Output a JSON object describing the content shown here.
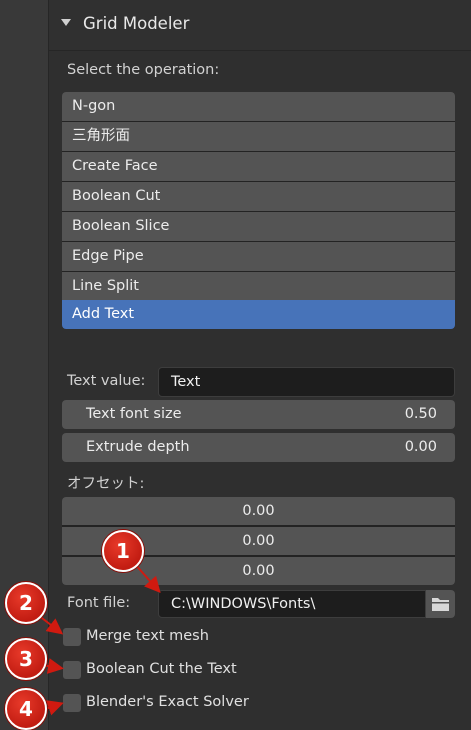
{
  "panel": {
    "title": "Grid Modeler",
    "operation_prompt": "Select the operation:",
    "operations": [
      {
        "label": "N-gon",
        "selected": false
      },
      {
        "label": "三角形面",
        "selected": false
      },
      {
        "label": "Create Face",
        "selected": false
      },
      {
        "label": "Boolean Cut",
        "selected": false
      },
      {
        "label": "Boolean Slice",
        "selected": false
      },
      {
        "label": "Edge Pipe",
        "selected": false
      },
      {
        "label": "Line Split",
        "selected": false
      },
      {
        "label": "Add Text",
        "selected": true
      }
    ],
    "text_value": {
      "label": "Text value:",
      "value": "Text"
    },
    "font_size": {
      "label": "Text font size",
      "value": "0.50"
    },
    "extrude_depth": {
      "label": "Extrude depth",
      "value": "0.00"
    },
    "offset": {
      "label": "オフセット:",
      "values": [
        "0.00",
        "0.00",
        "0.00"
      ]
    },
    "font_file": {
      "label": "Font file:",
      "value": "C:\\WINDOWS\\Fonts\\"
    },
    "checkboxes": [
      {
        "label": "Merge text mesh",
        "checked": false
      },
      {
        "label": "Boolean Cut the Text",
        "checked": false
      },
      {
        "label": "Blender's Exact Solver",
        "checked": false
      }
    ]
  },
  "callouts": [
    "1",
    "2",
    "3",
    "4"
  ],
  "colors": {
    "selected_accent": "#4773b9",
    "callout_red": "#c21c12"
  },
  "icons": {
    "collapse": "triangle-down-icon",
    "file_browse": "folder-icon"
  }
}
